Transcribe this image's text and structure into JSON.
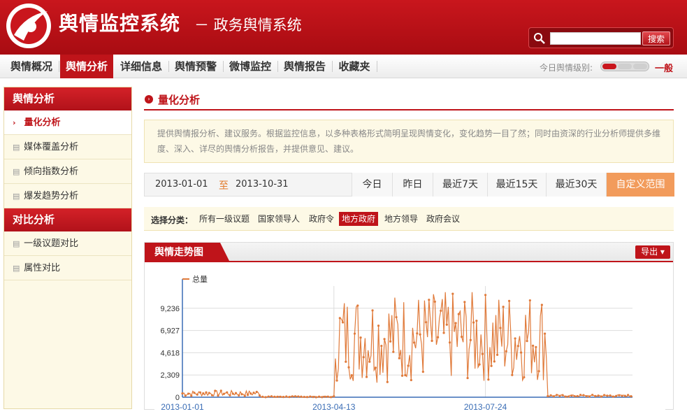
{
  "header": {
    "brand": "舆情监控系统",
    "subbrand": "－ 政务舆情系统",
    "search_placeholder": "",
    "search_button": "搜索"
  },
  "nav": {
    "items": [
      {
        "label": "舆情概况",
        "active": false
      },
      {
        "label": "舆情分析",
        "active": true
      },
      {
        "label": "详细信息",
        "active": false
      },
      {
        "label": "舆情预警",
        "active": false
      },
      {
        "label": "微博监控",
        "active": false
      },
      {
        "label": "舆情报告",
        "active": false
      },
      {
        "label": "收藏夹",
        "active": false
      }
    ],
    "level_label": "今日舆情级别:",
    "level_value": "一般"
  },
  "sidebar": {
    "groups": [
      {
        "title": "舆情分析",
        "items": [
          {
            "label": "量化分析",
            "active": true,
            "icon": "chevron-right-icon"
          },
          {
            "label": "媒体覆盖分析",
            "active": false,
            "icon": "document-icon"
          },
          {
            "label": "倾向指数分析",
            "active": false,
            "icon": "document-icon"
          },
          {
            "label": "爆发趋势分析",
            "active": false,
            "icon": "document-icon"
          }
        ]
      },
      {
        "title": "对比分析",
        "items": [
          {
            "label": "一级议题对比",
            "active": false,
            "icon": "document-icon"
          },
          {
            "label": "属性对比",
            "active": false,
            "icon": "document-icon"
          }
        ]
      }
    ]
  },
  "main": {
    "title": "量化分析",
    "intro": "提供舆情报分析、建议服务。根据监控信息，以多种表格形式简明呈现舆情变化，变化趋势一目了然；同时由资深的行业分析师提供多维度、深入、详尽的舆情分析报告，并提供意见、建议。",
    "date_from": "2013-01-01",
    "date_to_sep": "至",
    "date_to": "2013-10-31",
    "ranges": [
      {
        "label": "今日",
        "active": false
      },
      {
        "label": "昨日",
        "active": false
      },
      {
        "label": "最近7天",
        "active": false
      },
      {
        "label": "最近15天",
        "active": false
      },
      {
        "label": "最近30天",
        "active": false
      },
      {
        "label": "自定义范围",
        "active": true
      }
    ],
    "category_label": "选择分类：",
    "categories": [
      {
        "label": "所有一级议题",
        "active": false
      },
      {
        "label": "国家领导人",
        "active": false
      },
      {
        "label": "政府令",
        "active": false
      },
      {
        "label": "地方政府",
        "active": true
      },
      {
        "label": "地方领导",
        "active": false
      },
      {
        "label": "政府会议",
        "active": false
      }
    ],
    "panel_title": "舆情走势图",
    "export_label": "导出"
  },
  "colors": {
    "brand_red": "#bf141a",
    "series_orange": "#e07a3a",
    "accent_orange": "#f29b5b"
  },
  "chart_data": {
    "type": "line",
    "series": [
      {
        "name": "总量"
      }
    ],
    "ylim": [
      0,
      11545
    ],
    "yticks": [
      "0",
      "2,309",
      "4,618",
      "6,927",
      "9,236"
    ],
    "xticks": [
      "2013-01-01",
      "2013-04-13",
      "2013-07-24"
    ],
    "x_start": "2013-01-01",
    "x_end": "2013-10-31",
    "grid": true,
    "legend_position": "top-left",
    "segments": [
      {
        "from": "2013-01-01",
        "to": "2013-02-22",
        "level_low": 100,
        "level_high": 700
      },
      {
        "from": "2013-02-23",
        "to": "2013-04-13",
        "level_low": 0,
        "level_high": 100
      },
      {
        "from": "2013-04-14",
        "to": "2013-09-03",
        "level_low": 1500,
        "level_high": 11000
      },
      {
        "from": "2013-09-04",
        "to": "2013-10-31",
        "level_low": 50,
        "level_high": 250
      }
    ]
  }
}
